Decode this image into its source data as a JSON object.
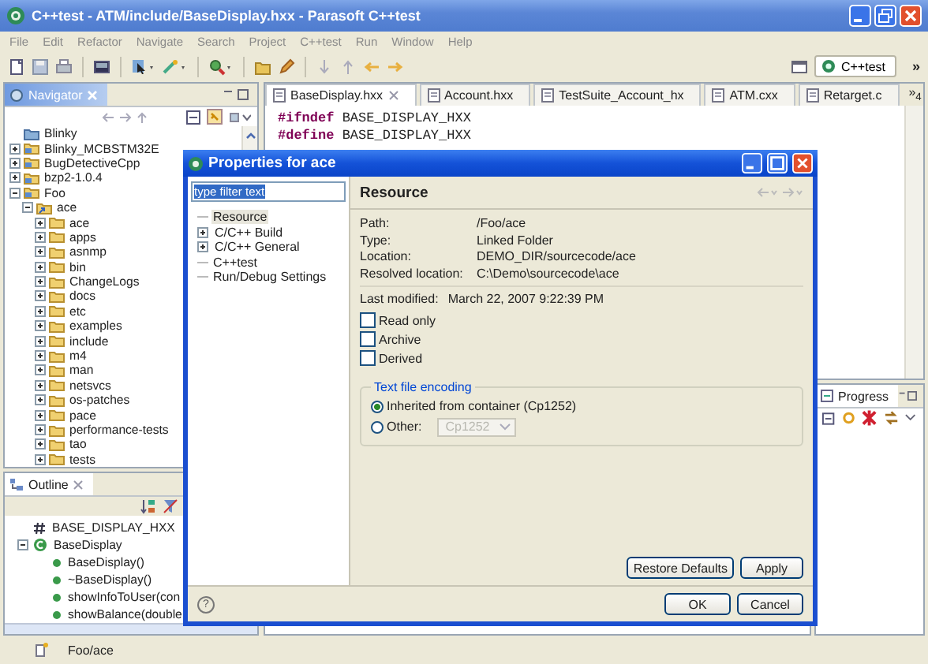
{
  "window": {
    "title": "C++test - ATM/include/BaseDisplay.hxx - Parasoft C++test"
  },
  "menu": [
    "File",
    "Edit",
    "Refactor",
    "Navigate",
    "Search",
    "Project",
    "C++test",
    "Run",
    "Window",
    "Help"
  ],
  "perspective": {
    "label": "C++test",
    "chevron": "»"
  },
  "navigator": {
    "title": "Navigator",
    "items": [
      {
        "label": "Blinky",
        "kind": "closed-project"
      },
      {
        "label": "Blinky_MCBSTM32E",
        "kind": "project",
        "expanded": false
      },
      {
        "label": "BugDetectiveCpp",
        "kind": "project",
        "expanded": false
      },
      {
        "label": "bzp2-1.0.4",
        "kind": "project",
        "expanded": false
      },
      {
        "label": "Foo",
        "kind": "project",
        "expanded": true,
        "children": [
          {
            "label": "ace",
            "kind": "linked-folder",
            "expanded": true,
            "children": [
              {
                "label": "ace",
                "kind": "folder",
                "expanded": false
              },
              {
                "label": "apps",
                "kind": "folder",
                "expanded": false
              },
              {
                "label": "asnmp",
                "kind": "folder",
                "expanded": false
              },
              {
                "label": "bin",
                "kind": "folder",
                "expanded": false
              },
              {
                "label": "ChangeLogs",
                "kind": "folder",
                "expanded": false
              },
              {
                "label": "docs",
                "kind": "folder",
                "expanded": false
              },
              {
                "label": "etc",
                "kind": "folder",
                "expanded": false
              },
              {
                "label": "examples",
                "kind": "folder",
                "expanded": false
              },
              {
                "label": "include",
                "kind": "folder",
                "expanded": false
              },
              {
                "label": "m4",
                "kind": "folder",
                "expanded": false
              },
              {
                "label": "man",
                "kind": "folder",
                "expanded": false
              },
              {
                "label": "netsvcs",
                "kind": "folder",
                "expanded": false
              },
              {
                "label": "os-patches",
                "kind": "folder",
                "expanded": false
              },
              {
                "label": "pace",
                "kind": "folder",
                "expanded": false
              },
              {
                "label": "performance-tests",
                "kind": "folder",
                "expanded": false
              },
              {
                "label": "tao",
                "kind": "folder",
                "expanded": false
              },
              {
                "label": "tests",
                "kind": "folder",
                "expanded": false
              }
            ]
          }
        ]
      }
    ]
  },
  "editor": {
    "tabs": [
      {
        "label": "BaseDisplay.hxx",
        "selected": true
      },
      {
        "label": "Account.hxx",
        "selected": false
      },
      {
        "label": "TestSuite_Account_hx",
        "selected": false
      },
      {
        "label": "ATM.cxx",
        "selected": false
      },
      {
        "label": "Retarget.c",
        "selected": false
      }
    ],
    "overflow": "»$_{4}$",
    "lines": [
      "**#ifndef** BASE_DISPLAY_HXX",
      "**#define** BASE_DISPLAY_HXX"
    ]
  },
  "outline": {
    "title": "Outline",
    "items": [
      {
        "label": "BASE_DISPLAY_HXX",
        "kind": "macro"
      },
      {
        "label": "BaseDisplay",
        "kind": "class",
        "expanded": true,
        "children": [
          {
            "label": "BaseDisplay()",
            "kind": "method"
          },
          {
            "label": "~BaseDisplay()",
            "kind": "method"
          },
          {
            "label": "showInfoToUser(con",
            "kind": "method"
          },
          {
            "label": "showBalance(double",
            "kind": "method"
          }
        ]
      }
    ]
  },
  "progress": {
    "title": "Progress"
  },
  "status_bar": {
    "path": "Foo/ace"
  },
  "dialog": {
    "title": "Properties for ace",
    "filter": {
      "value": "type filter text"
    },
    "tree": [
      {
        "label": "Resource",
        "selected": true
      },
      {
        "label": "C/C++ Build",
        "selected": false,
        "expanded": false
      },
      {
        "label": "C/C++ General",
        "selected": false,
        "expanded": false
      },
      {
        "label": "C++test",
        "selected": false
      },
      {
        "label": "Run/Debug Settings",
        "selected": false
      }
    ],
    "page": {
      "heading": "Resource",
      "info": [
        {
          "label": "Path:",
          "value": "/Foo/ace"
        },
        {
          "label": "Type:",
          "value": "Linked Folder"
        },
        {
          "label": "Location:",
          "value": "DEMO_DIR/sourcecode/ace"
        },
        {
          "label": "Resolved location:",
          "value": "C:\\Demo\\sourcecode\\ace"
        }
      ],
      "modified": {
        "label": "Last modified:",
        "value": "March 22, 2007 9:22:39 PM"
      },
      "attributes": [
        {
          "label": "Read only",
          "checked": false
        },
        {
          "label": "Archive",
          "checked": false
        },
        {
          "label": "Derived",
          "checked": false
        }
      ],
      "encoding": {
        "legend": "Text file encoding",
        "options": [
          {
            "label": "Inherited from container (Cp1252)",
            "selected": true
          },
          {
            "label": "Other:",
            "selected": false
          }
        ],
        "combo": {
          "value": "Cp1252",
          "disabled": true
        }
      },
      "buttons": [
        "Restore Defaults",
        "Apply"
      ]
    },
    "help": "?",
    "buttons": [
      "OK",
      "Cancel"
    ]
  }
}
